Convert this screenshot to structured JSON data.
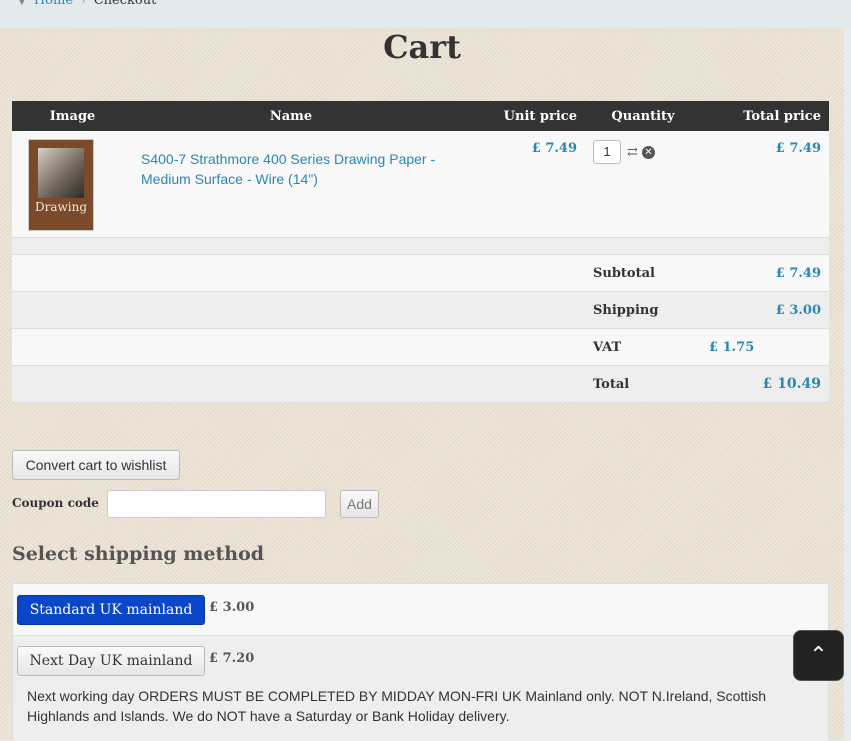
{
  "breadcrumb": {
    "home": "Home",
    "separator": "›",
    "current": "Checkout"
  },
  "page": {
    "title": "Cart"
  },
  "table": {
    "headers": {
      "image": "Image",
      "name": "Name",
      "unit_price": "Unit price",
      "quantity": "Quantity",
      "total_price": "Total price"
    },
    "item": {
      "thumb_text": "Drawing",
      "name": "S400-7 Strathmore 400 Series Drawing Paper - Medium Surface - Wire (14\")",
      "unit_price": "£ 7.49",
      "quantity": "1",
      "total_price": "£ 7.49",
      "update_icon": "refresh-icon",
      "remove_icon": "close-circle-icon"
    },
    "summary": {
      "subtotal_label": "Subtotal",
      "subtotal_value": "£ 7.49",
      "shipping_label": "Shipping",
      "shipping_value": "£ 3.00",
      "vat_label": "VAT",
      "vat_value": "£ 1.75",
      "total_label": "Total",
      "total_value": "£ 10.49"
    }
  },
  "actions": {
    "wishlist_label": "Convert cart to wishlist"
  },
  "coupon": {
    "label": "Coupon code",
    "value": "",
    "add_label": "Add"
  },
  "shipping": {
    "title": "Select shipping method",
    "methods": [
      {
        "label": "Standard UK mainland",
        "price": "£ 3.00",
        "selected": true
      },
      {
        "label": "Next Day UK mainland",
        "price": "£ 7.20",
        "selected": false
      }
    ],
    "note": "Next working day ORDERS MUST BE COMPLETED BY MIDDAY MON-FRI UK Mainland only. NOT N.Ireland, Scottish Highlands and Islands. We do NOT have a Saturday or Bank Holiday delivery."
  },
  "scroll_top": {
    "icon": "chevron-up-icon",
    "glyph": "⌃"
  },
  "colors": {
    "accent": "#2a86b3",
    "header_bg": "#333333",
    "selected_button": "#0a47c8"
  }
}
